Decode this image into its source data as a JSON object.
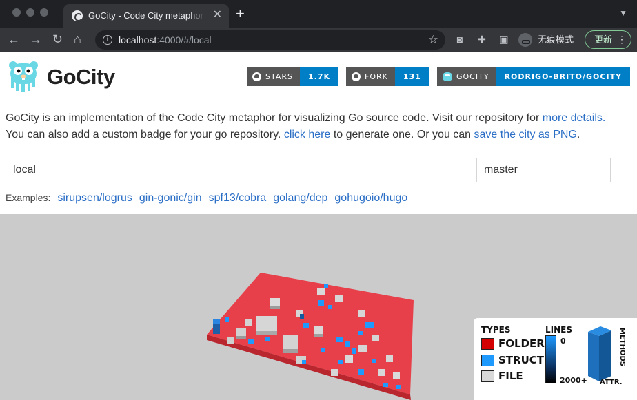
{
  "browser": {
    "tab_title": "GoCity - Code City metaphor for visualizing Go source code",
    "url_host": "localhost",
    "url_rest": ":4000/#/local",
    "incognito_label": "无痕模式",
    "update_label": "更新"
  },
  "header": {
    "brand": "GoCity",
    "badges": [
      {
        "label": "STARS",
        "value": "1.7K"
      },
      {
        "label": "FORK",
        "value": "131"
      },
      {
        "label": "GOCITY",
        "value": "RODRIGO-BRITO/GOCITY"
      }
    ]
  },
  "description": {
    "line1_text": "GoCity is an implementation of the Code City metaphor for visualizing Go source code. Visit our repository for ",
    "line1_link": "more details.",
    "line2_text_a": "You can also add a custom badge for your go repository. ",
    "line2_link_a": "click here",
    "line2_text_b": " to generate one. Or you can ",
    "line2_link_b": "save the city as PNG",
    "line2_text_c": "."
  },
  "form": {
    "repo_value": "local",
    "branch_value": "master"
  },
  "examples": {
    "label": "Examples:",
    "items": [
      "sirupsen/logrus",
      "gin-gonic/gin",
      "spf13/cobra",
      "golang/dep",
      "gohugoio/hugo"
    ]
  },
  "legend": {
    "types_title": "TYPES",
    "lines_title": "LINES",
    "types": [
      {
        "label": "FOLDER",
        "color": "#d40000"
      },
      {
        "label": "STRUCT",
        "color": "#1e9aff"
      },
      {
        "label": "FILE",
        "color": "#d8d8d8"
      }
    ],
    "lines_min": "0",
    "lines_max": "2000+",
    "methods_label": "METHODS",
    "attr_label": "ATTR."
  },
  "colors": {
    "accent": "#2a6ec6",
    "badge_value": "#007ec6",
    "platform": "#e8404a"
  }
}
